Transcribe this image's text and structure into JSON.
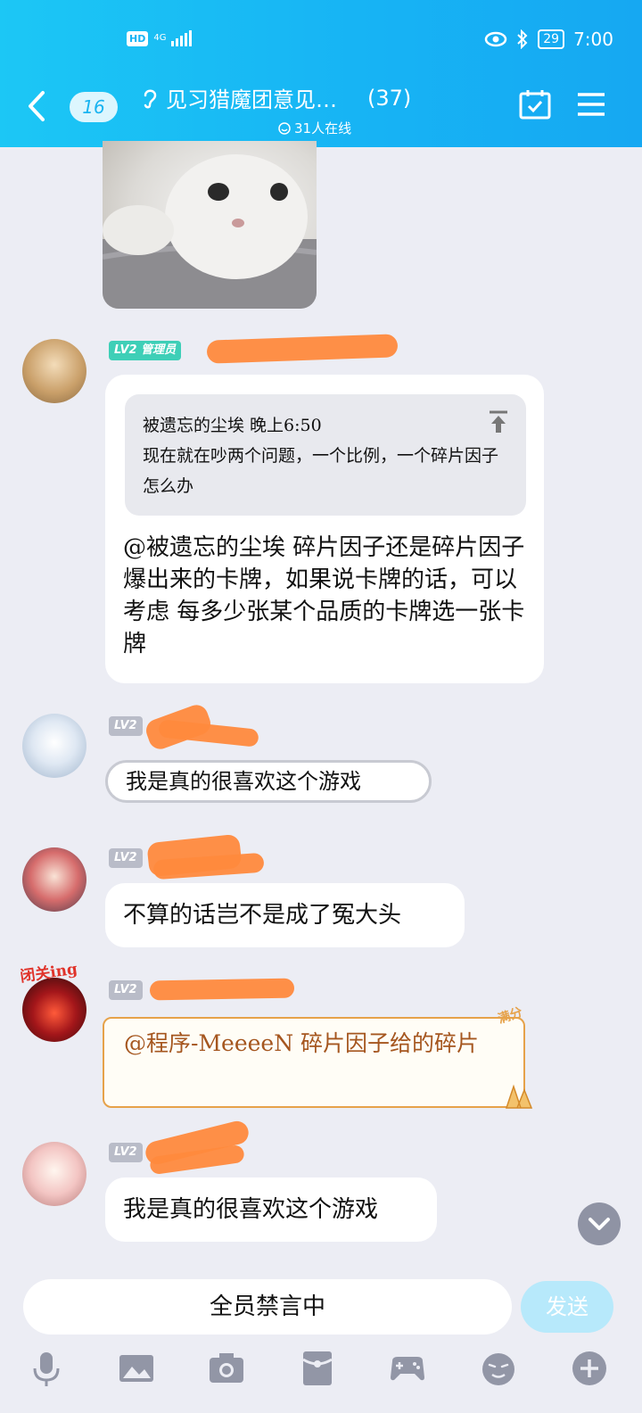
{
  "status": {
    "network": "4G",
    "hd": "HD",
    "battery": "29",
    "time": "7:00"
  },
  "header": {
    "unread": "16",
    "title": "见习猎魔团意见…",
    "member_count": "(37)",
    "online": "31人在线"
  },
  "messages": [
    {
      "level": "LV2",
      "role": "管理员",
      "quote": {
        "author_time": "被遗忘的尘埃 晚上6:50",
        "text": "现在就在吵两个问题，一个比例，一个碎片因子怎么办"
      },
      "text": "@被遗忘的尘埃 碎片因子还是碎片因子爆出来的卡牌，如果说卡牌的话，可以考虑 每多少张某个品质的卡牌选一张卡牌"
    },
    {
      "level": "LV2",
      "text": "我是真的很喜欢这个游戏"
    },
    {
      "level": "LV2",
      "text": "不算的话岂不是成了冤大头"
    },
    {
      "level": "LV2",
      "avatar_badge": "闭关ing",
      "text": "@程序-MeeeeN 碎片因子给的碎片",
      "deco": "满分"
    },
    {
      "level": "LV2",
      "text": "我是真的很喜欢这个游戏"
    }
  ],
  "input": {
    "placeholder": "全员禁言中",
    "send_label": "发送"
  },
  "toolbar_icons": [
    "mic-icon",
    "image-icon",
    "camera-icon",
    "red-packet-icon",
    "game-icon",
    "emoji-icon",
    "plus-icon"
  ]
}
